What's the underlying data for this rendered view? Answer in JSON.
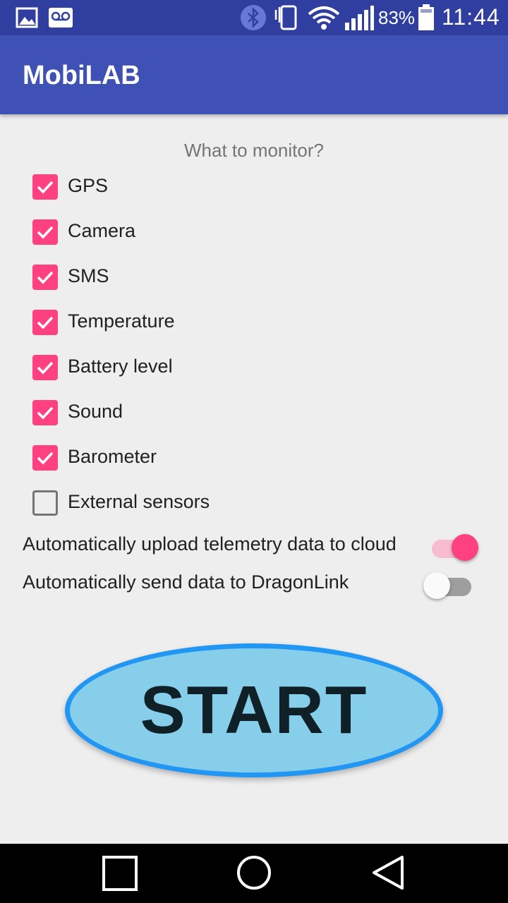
{
  "status_bar": {
    "icons": [
      "image-icon",
      "voicemail-icon",
      "bluetooth-icon",
      "vibrate-icon",
      "wifi-icon",
      "signal-icon",
      "battery-icon"
    ],
    "battery_percent": "83%",
    "time": "11:44"
  },
  "app_bar": {
    "title": "MobiLAB"
  },
  "prompt": "What to monitor?",
  "checkboxes": [
    {
      "label": "GPS",
      "checked": true
    },
    {
      "label": "Camera",
      "checked": true
    },
    {
      "label": "SMS",
      "checked": true
    },
    {
      "label": "Temperature",
      "checked": true
    },
    {
      "label": "Battery level",
      "checked": true
    },
    {
      "label": "Sound",
      "checked": true
    },
    {
      "label": "Barometer",
      "checked": true
    },
    {
      "label": "External sensors",
      "checked": false
    }
  ],
  "switches": [
    {
      "label": "Automatically upload telemetry data to cloud",
      "on": true
    },
    {
      "label": "Automatically send data to DragonLink",
      "on": false
    }
  ],
  "start_button": {
    "label": "START"
  },
  "nav_bar": {
    "icons": [
      "recents-square-icon",
      "home-circle-icon",
      "back-triangle-icon"
    ]
  },
  "colors": {
    "status_bar": "#303f9f",
    "app_bar": "#3f51b5",
    "accent": "#ff4081",
    "start_fill": "#87ceeb",
    "start_border": "#2196f3"
  }
}
